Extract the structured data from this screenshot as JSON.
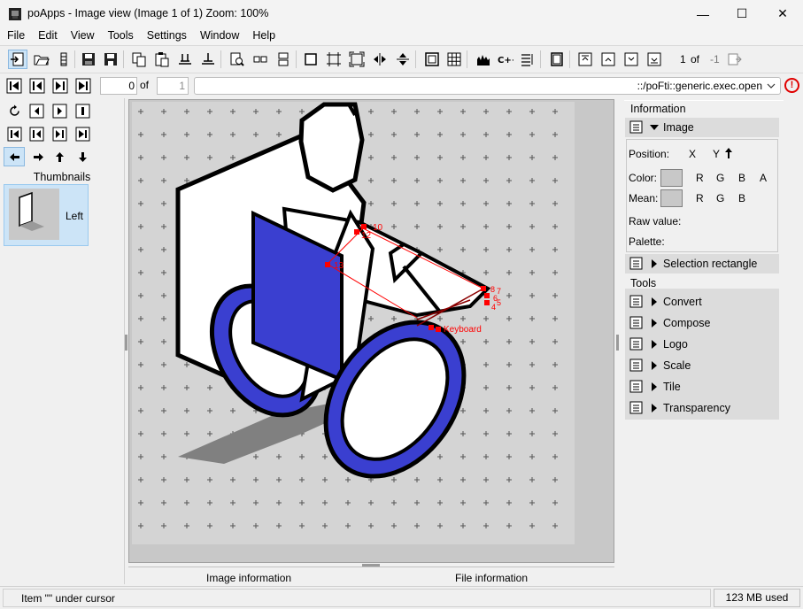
{
  "window": {
    "title": "poApps - Image view (Image 1 of 1) Zoom: 100%",
    "minimize": "—",
    "maximize": "☐",
    "close": "✕"
  },
  "menu": [
    "File",
    "Edit",
    "View",
    "Tools",
    "Settings",
    "Window",
    "Help"
  ],
  "toolbar": {
    "page_current": "1",
    "page_of": "of",
    "page_total": "-1"
  },
  "nav": {
    "index_value": "0",
    "of_label": "of",
    "count_value": "1",
    "command": "::/poFti::generic.exec.open",
    "error_icon": "!"
  },
  "thumbnails": {
    "header": "Thumbnails",
    "items": [
      {
        "label": "Left"
      }
    ]
  },
  "image_view": {
    "annotations": [
      "10",
      "12",
      "13",
      "8",
      "7",
      "6",
      "5",
      "4",
      "Keyboard"
    ],
    "colors": {
      "background": "#c8c8c8",
      "tile": "#d4d4d4",
      "blue": "#3a3fd0",
      "annotation": "#ff0000",
      "shadow": "#808080"
    }
  },
  "bottom_tabs": [
    "Image information",
    "File information"
  ],
  "info_panel": {
    "section_title": "Information",
    "image_row": "Image",
    "position_label": "Position:",
    "x_label": "X",
    "y_label": "Y",
    "color_label": "Color:",
    "mean_label": "Mean:",
    "rgba": [
      "R",
      "G",
      "B",
      "A"
    ],
    "rgb": [
      "R",
      "G",
      "B"
    ],
    "raw_value_label": "Raw value:",
    "palette_label": "Palette:",
    "selection_row": "Selection rectangle"
  },
  "tools_panel": {
    "section_title": "Tools",
    "items": [
      "Convert",
      "Compose",
      "Logo",
      "Scale",
      "Tile",
      "Transparency"
    ]
  },
  "status": {
    "left": "Item \"\" under cursor",
    "memory": "123 MB used"
  }
}
